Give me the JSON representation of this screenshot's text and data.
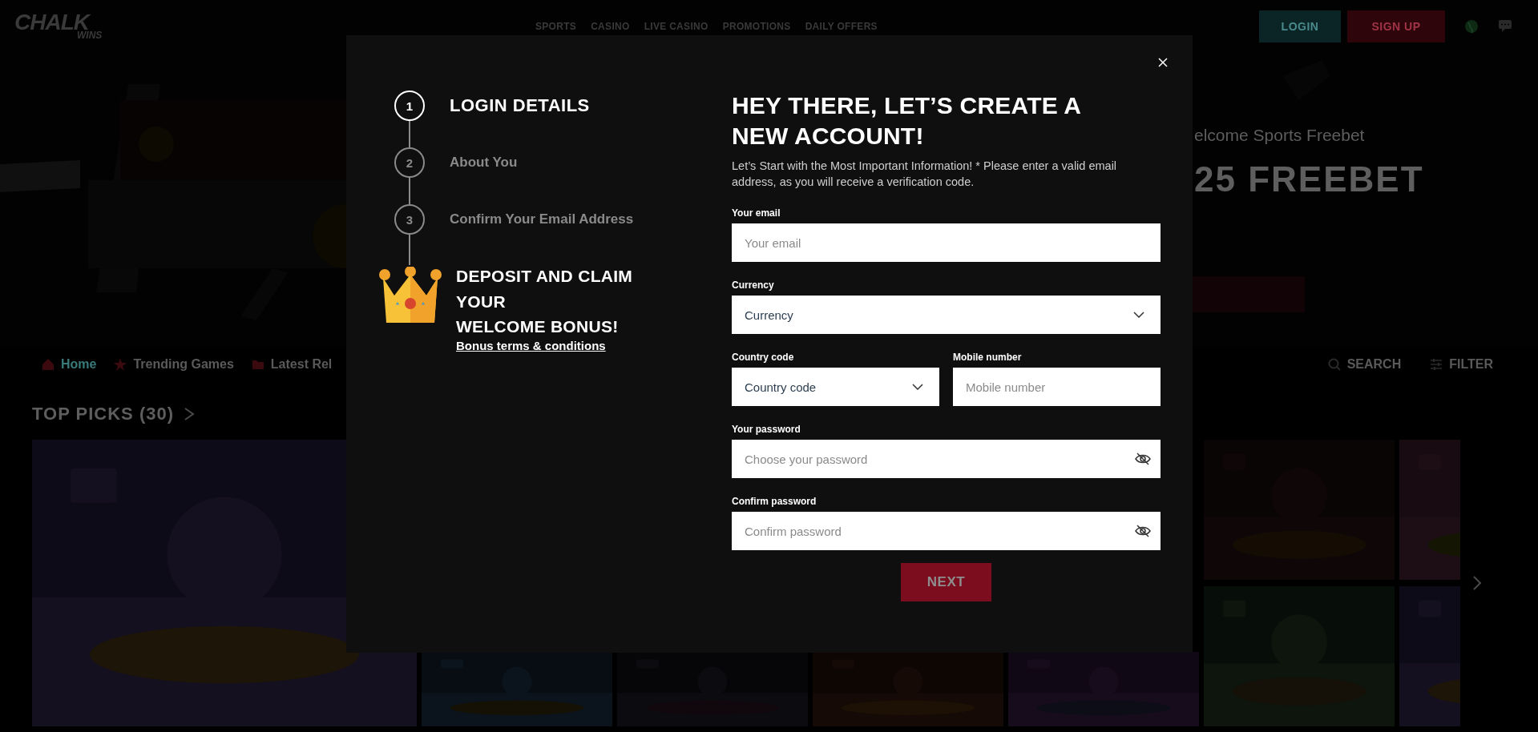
{
  "header": {
    "logo": {
      "main": "CHALK",
      "sub": "WINS"
    },
    "nav": [
      "SPORTS",
      "CASINO",
      "LIVE CASINO",
      "PROMOTIONS",
      "DAILY OFFERS"
    ],
    "login_button": "LOGIN",
    "signup_button": "SIGN UP"
  },
  "hero": {
    "kind": "picture",
    "subtitle": "elcome Sports Freebet",
    "headline": "25 FREEBET"
  },
  "categories": [
    {
      "label": "Home",
      "selected": true
    },
    {
      "label": "Trending Games",
      "selected": false
    },
    {
      "label": "Latest Rel",
      "selected": false
    }
  ],
  "tools": [
    {
      "kind": "search",
      "label": "SEARCH"
    },
    {
      "kind": "filter",
      "label": "FILTER"
    }
  ],
  "section_title": "TOP PICKS (30)",
  "modal": {
    "steps": [
      {
        "number": "1",
        "label": "LOGIN DETAILS",
        "selected": true
      },
      {
        "number": "2",
        "label": "About You",
        "selected": false
      },
      {
        "number": "3",
        "label": "Confirm Your Email Address",
        "selected": false
      }
    ],
    "promo": {
      "title_lines": [
        "DEPOSIT AND CLAIM YOUR",
        "WELCOME BONUS!"
      ],
      "link": "Bonus terms & conditions"
    },
    "title": "HEY THERE, LET’S CREATE A NEW ACCOUNT!",
    "intro": "Let’s Start with the Most Important Information! * Please enter a valid email address, as you will receive a verification code.",
    "rows": [
      [
        {
          "kind": "text",
          "label": "Your email",
          "placeholder": "Your email"
        }
      ],
      [
        {
          "kind": "select",
          "label": "Currency",
          "value": "Currency"
        }
      ],
      [
        {
          "kind": "select",
          "label": "Country code",
          "value": "Country code"
        },
        {
          "kind": "text",
          "label": "Mobile number",
          "placeholder": "Mobile number"
        }
      ],
      [
        {
          "kind": "password",
          "label": "Your password",
          "placeholder": "Choose your password"
        }
      ],
      [
        {
          "kind": "password",
          "label": "Confirm password",
          "placeholder": "Confirm password"
        }
      ]
    ],
    "submit": {
      "label": "NEXT",
      "disabled": true
    }
  }
}
